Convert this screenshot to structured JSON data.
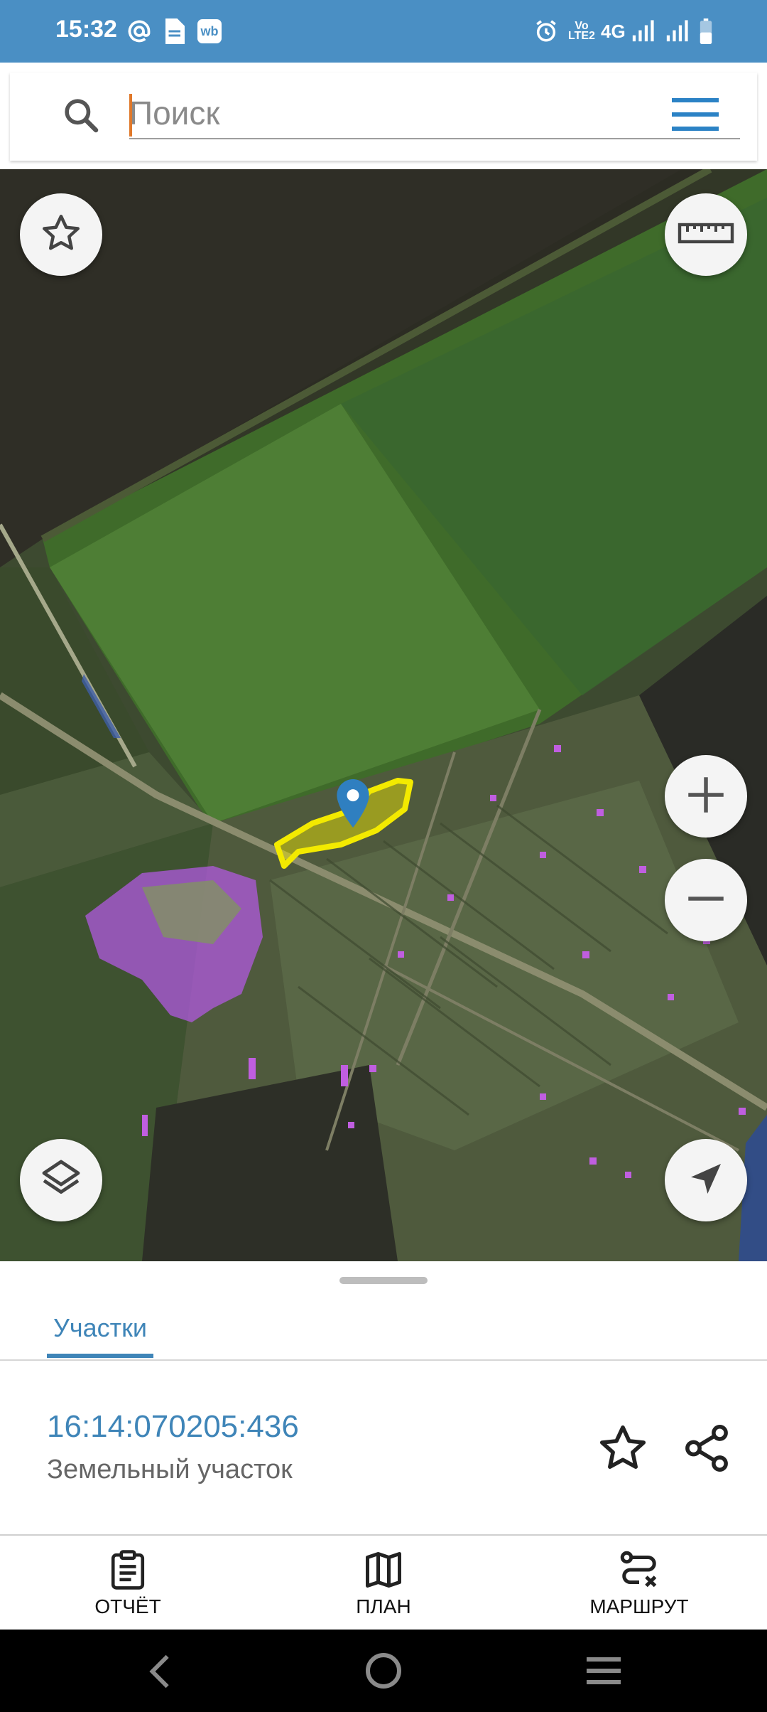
{
  "status_bar": {
    "time": "15:32",
    "left_icons": [
      "at-icon",
      "document-icon",
      "wb-app-icon"
    ],
    "wb_label": "wb",
    "right_icons": [
      "alarm-icon",
      "volte-icon",
      "4g-icon",
      "signal-icon",
      "signal-icon",
      "battery-icon"
    ],
    "network": "4G"
  },
  "search": {
    "placeholder": "Поиск",
    "value": ""
  },
  "map": {
    "buttons": [
      "favorites-star-icon",
      "ruler-icon",
      "zoom-in-icon",
      "zoom-out-icon",
      "layers-icon",
      "navigation-arrow-icon"
    ],
    "highlight_color": "#f3ea00",
    "marker_color": "#2f7fc0",
    "zone_color": "#b05adf"
  },
  "sheet": {
    "tab_label": "Участки",
    "parcel_id": "16:14:070205:436",
    "parcel_type": "Земельный участок"
  },
  "bottom_nav": {
    "report_label": "ОТЧЁТ",
    "plan_label": "ПЛАН",
    "route_label": "МАРШРУТ"
  },
  "colors": {
    "accent": "#3f85b8",
    "status_bar": "#4a8fc4"
  }
}
